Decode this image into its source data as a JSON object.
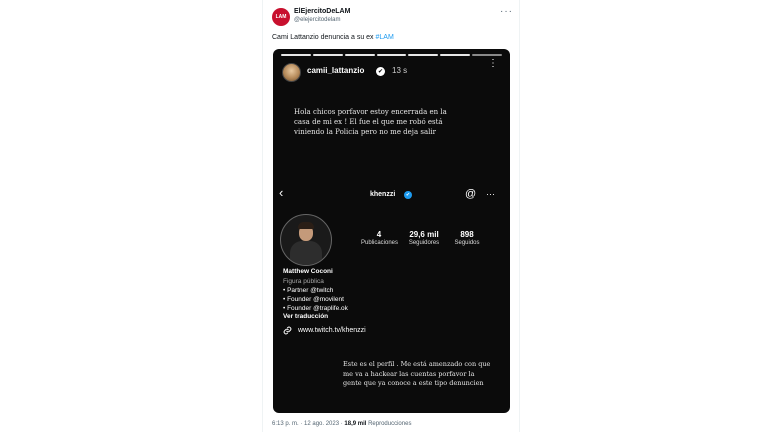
{
  "tweet": {
    "avatar_label": "LAM",
    "display_name": "ElEjercitoDeLAM",
    "handle": "@elejercitodelam",
    "more": "···",
    "text": "Cami Lattanzio denuncia a su ex",
    "hashtag": "#LAM",
    "time": "6:13 p. m. · 12 ago. 2023 ·",
    "views_count": "18,9 mil",
    "views_label": "Reproducciones"
  },
  "story": {
    "username": "camii_lattanzio",
    "verified_glyph": "✔",
    "time": "13 s",
    "menu": "⋮",
    "message_top": "Hola chicos porfavor estoy encerrada en la casa de mi ex ! El fue el que me robó está viniendo la Policia pero no me deja salir",
    "message_bottom": "Este es el perfil . Me está amenzado con que me va a hackear las cuentas porfavor la gente que ya conoce a este tipo denuncien"
  },
  "profile": {
    "back": "‹",
    "username": "khenzzi",
    "verified_glyph": "✔",
    "threads_glyph": "@",
    "more": "···",
    "stats": [
      {
        "num": "4",
        "label": "Publicaciones"
      },
      {
        "num": "29,6 mil",
        "label": "Seguidores"
      },
      {
        "num": "898",
        "label": "Seguidos"
      }
    ],
    "name": "Matthew Coconi",
    "category": "Figura pública",
    "bio_lines": [
      "• Partner @twitch",
      "• Founder @movilent",
      "• Founder @traplife.ok"
    ],
    "translate": "Ver traducción",
    "link_icon": "🔗",
    "link": "www.twitch.tv/khenzzi"
  },
  "colors": {
    "accent": "#1d9bf0",
    "story_bg": "#0b0b0b",
    "avatar_red": "#c8102e"
  }
}
